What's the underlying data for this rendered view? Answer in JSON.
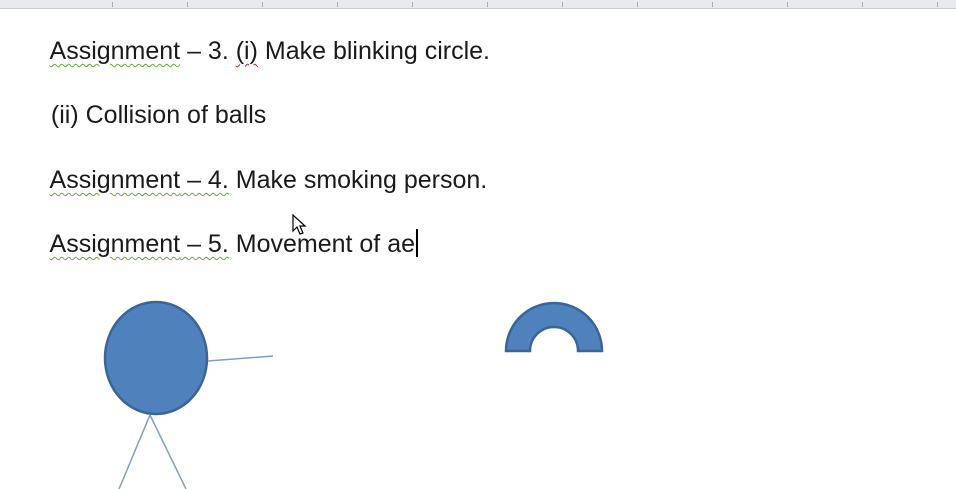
{
  "document": {
    "line1": {
      "prefix": "Assignment",
      "dash": " – 3. ",
      "paren": "(i)",
      "rest": " Make blinking circle."
    },
    "line2": {
      "text": "(ii) Collision of balls"
    },
    "line3": {
      "prefix": "Assignment",
      "dash": " – 4.",
      "rest": " Make smoking person."
    },
    "line4": {
      "prefix": "Assignment",
      "dash": " – 5.",
      "rest": " Movement of ae"
    }
  },
  "drawing": {
    "shape_fill": "#4f81bd",
    "shape_stroke": "#3a6596",
    "line_color": "#7ea0c8",
    "shapes": [
      "head-circle",
      "arm-line",
      "leg-left-line",
      "leg-right-line",
      "block-arc"
    ]
  },
  "colors": {
    "grammar_squiggle": "#5fae3a",
    "spelling_squiggle": "#d02020",
    "ruler_bg": "#e8eaee"
  }
}
